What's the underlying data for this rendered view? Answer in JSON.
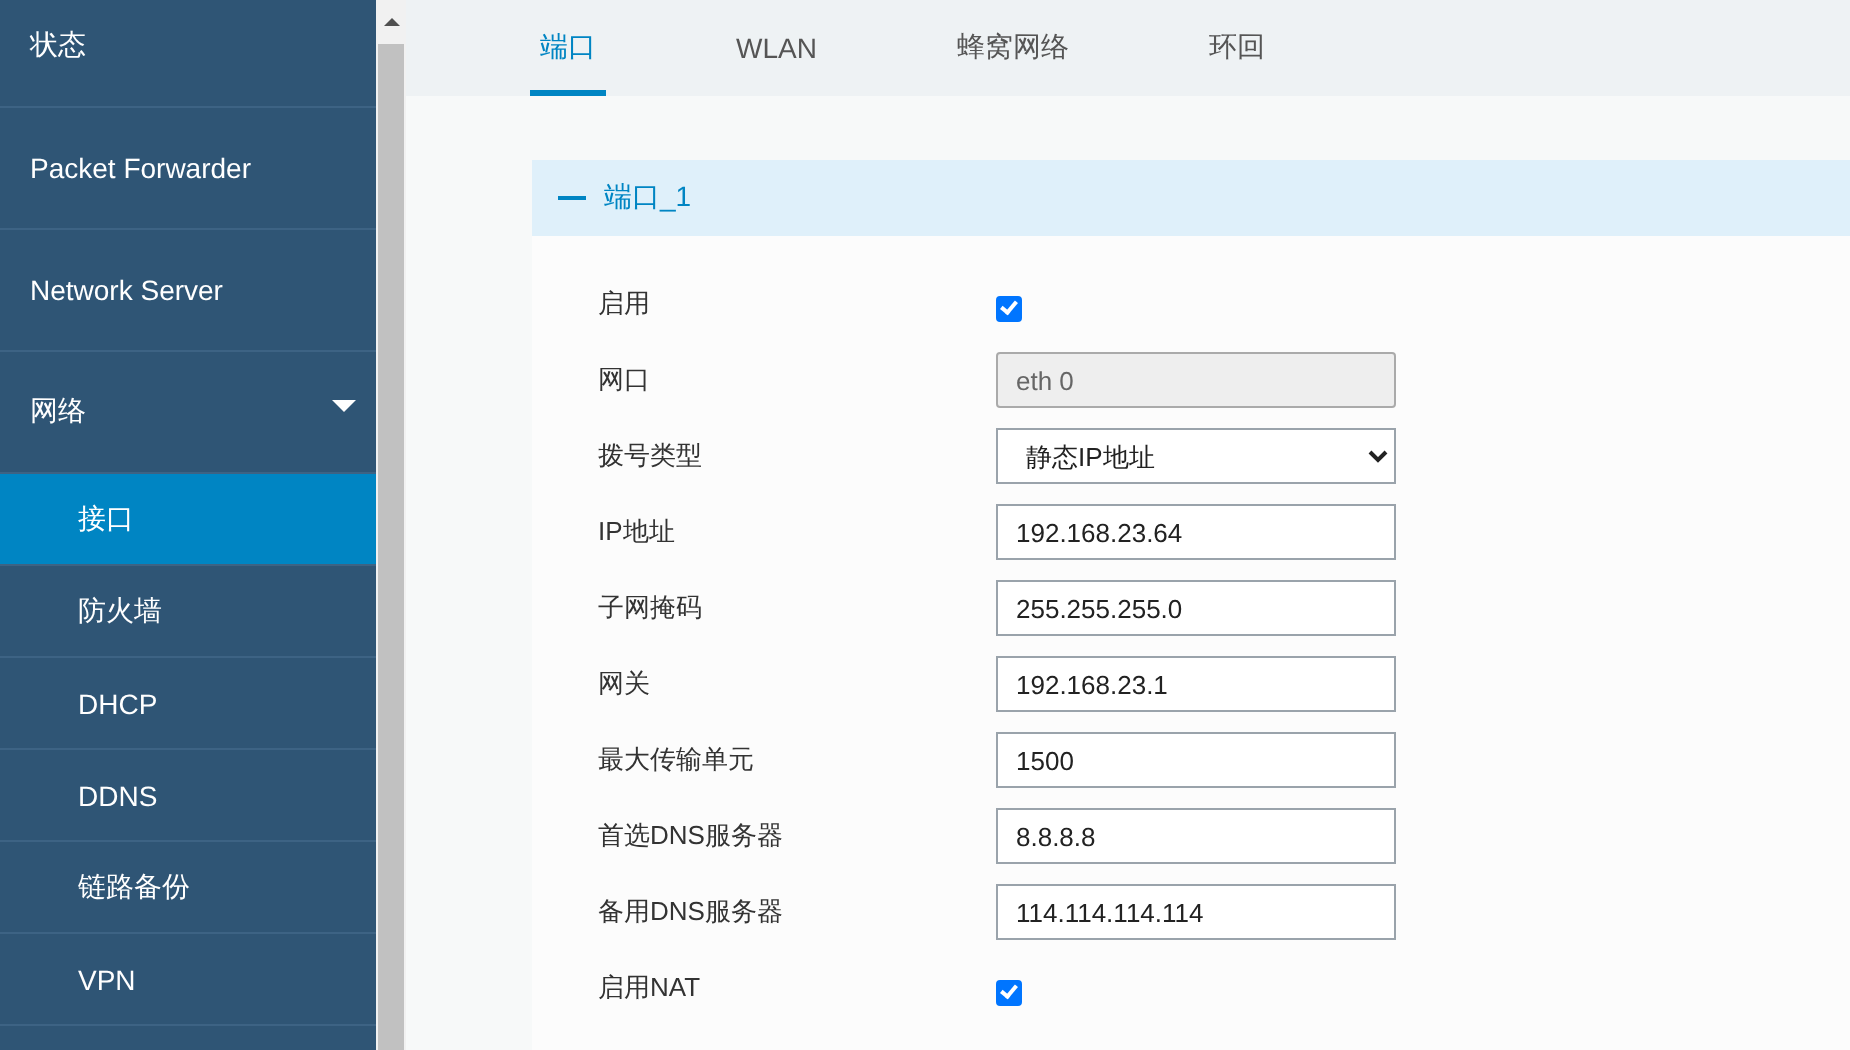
{
  "sidebar": {
    "items": [
      {
        "label": "状态",
        "selected": false
      },
      {
        "label": "Packet Forwarder",
        "selected": false
      },
      {
        "label": "Network Server",
        "selected": false
      },
      {
        "label": "网络",
        "selected": false,
        "expanded": true,
        "children": [
          {
            "label": "接口",
            "selected": true
          },
          {
            "label": "防火墙",
            "selected": false
          },
          {
            "label": "DHCP",
            "selected": false
          },
          {
            "label": "DDNS",
            "selected": false
          },
          {
            "label": "链路备份",
            "selected": false
          },
          {
            "label": "VPN",
            "selected": false
          }
        ]
      }
    ]
  },
  "tabs": [
    {
      "label": "端口",
      "selected": true
    },
    {
      "label": "WLAN",
      "selected": false
    },
    {
      "label": "蜂窝网络",
      "selected": false
    },
    {
      "label": "环回",
      "selected": false
    }
  ],
  "section": {
    "title": "端口_1",
    "expanded": true,
    "fields": [
      {
        "label": "启用",
        "kind": "checkbox",
        "checked": true
      },
      {
        "label": "网口",
        "kind": "readonly",
        "value": "eth 0"
      },
      {
        "label": "拨号类型",
        "kind": "select",
        "value": "静态IP地址"
      },
      {
        "label": "IP地址",
        "kind": "text",
        "value": "192.168.23.64"
      },
      {
        "label": "子网掩码",
        "kind": "text",
        "value": "255.255.255.0"
      },
      {
        "label": "网关",
        "kind": "text",
        "value": "192.168.23.1"
      },
      {
        "label": "最大传输单元",
        "kind": "text",
        "value": "1500"
      },
      {
        "label": "首选DNS服务器",
        "kind": "text",
        "value": "8.8.8.8"
      },
      {
        "label": "备用DNS服务器",
        "kind": "text",
        "value": "114.114.114.114"
      },
      {
        "label": "启用NAT",
        "kind": "checkbox",
        "checked": true
      }
    ]
  }
}
